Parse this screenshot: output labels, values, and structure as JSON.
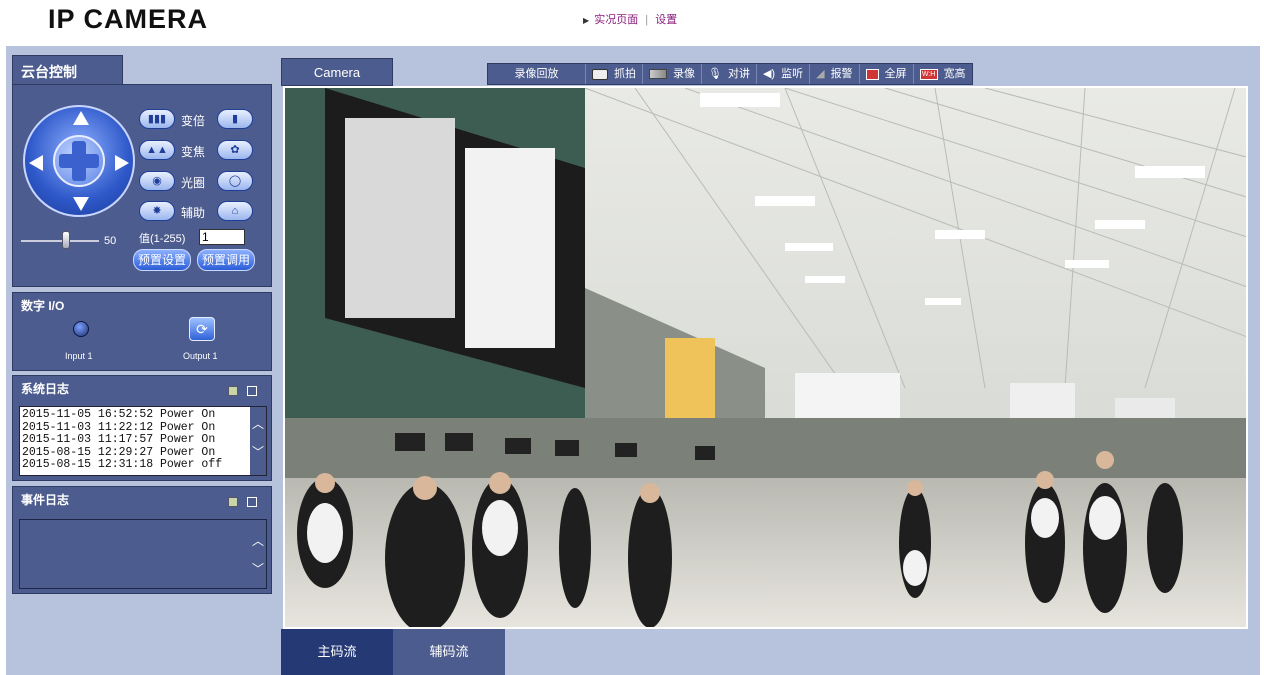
{
  "header": {
    "logo": "IP CAMERA",
    "nav_live": "实况页面",
    "nav_sep": "|",
    "nav_settings": "设置"
  },
  "ptz": {
    "tab": "云台控制",
    "zoom": "变倍",
    "focus": "变焦",
    "iris": "光圈",
    "aux": "辅助",
    "speed_value": "50",
    "value_label": "值(1-255)",
    "value_input": "1",
    "preset_set": "预置设置",
    "preset_call": "预置调用"
  },
  "dio": {
    "title": "数字 I/O",
    "input_label": "Input 1",
    "output_label": "Output 1"
  },
  "syslog": {
    "title": "系统日志",
    "entries": [
      "2015-11-05 16:52:52 Power On",
      "2015-11-03 11:22:12 Power On",
      "2015-11-03 11:17:57 Power On",
      "2015-08-15 12:29:27 Power On",
      "2015-08-15 12:31:18 Power off"
    ]
  },
  "evlog": {
    "title": "事件日志"
  },
  "camera": {
    "tab": "Camera",
    "toolbar": {
      "playback": "录像回放",
      "snapshot": "抓拍",
      "record": "录像",
      "talk": "对讲",
      "listen": "监听",
      "alarm": "报警",
      "fullscreen": "全屏",
      "aspect": "宽高",
      "aspect_icon": "W:H"
    }
  },
  "streams": {
    "main": "主码流",
    "sub": "辅码流"
  },
  "colors": {
    "panel": "#4d5c8e",
    "frame": "#b7c2dd",
    "active_stream": "#253a75",
    "nav_link": "#8a1c7c"
  }
}
